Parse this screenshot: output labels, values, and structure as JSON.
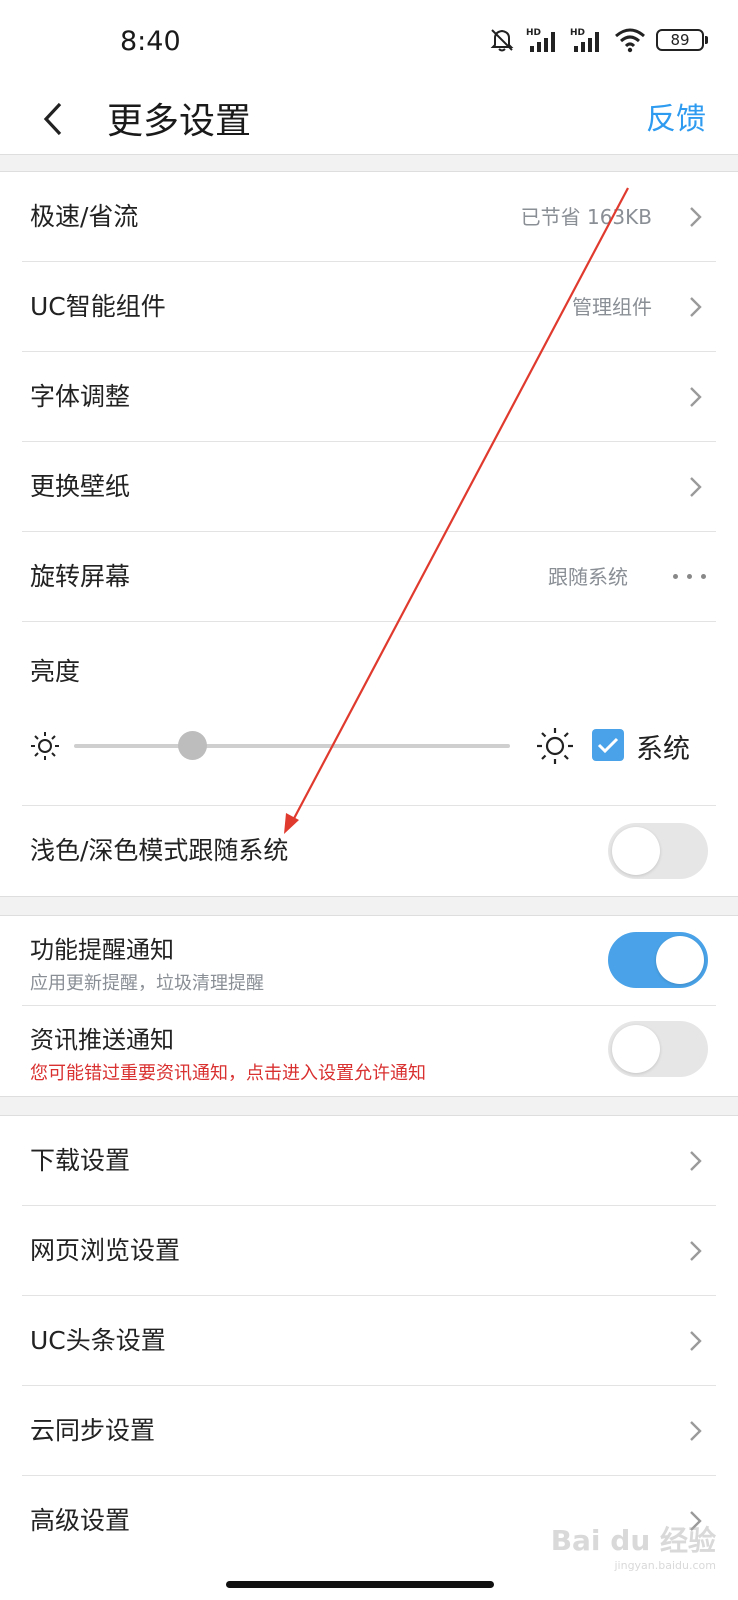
{
  "status_bar": {
    "time": "8:40",
    "battery": "89",
    "network_labels": [
      "HD",
      "HD"
    ]
  },
  "header": {
    "title": "更多设置",
    "feedback": "反馈"
  },
  "section1": {
    "speed": {
      "label": "极速/省流",
      "value": "已节省 163KB"
    },
    "widget": {
      "label": "UC智能组件",
      "value": "管理组件"
    },
    "font": {
      "label": "字体调整"
    },
    "wallpaper": {
      "label": "更换壁纸"
    },
    "rotate": {
      "label": "旋转屏幕",
      "value": "跟随系统"
    },
    "brightness": {
      "label": "亮度",
      "system_label": "系统",
      "system_checked": true,
      "level": 0.27
    },
    "dark_mode": {
      "label": "浅色/深色模式跟随系统",
      "enabled": false
    }
  },
  "section2": {
    "feature_notice": {
      "label": "功能提醒通知",
      "sub": "应用更新提醒，垃圾清理提醒",
      "enabled": true
    },
    "news_notice": {
      "label": "资讯推送通知",
      "sub": "您可能错过重要资讯通知，点击进入设置允许通知",
      "enabled": false
    }
  },
  "section3": {
    "items": [
      {
        "label": "下载设置"
      },
      {
        "label": "网页浏览设置"
      },
      {
        "label": "UC头条设置"
      },
      {
        "label": "云同步设置"
      },
      {
        "label": "高级设置"
      }
    ]
  },
  "watermark": {
    "main": "Bai du 经验",
    "sub": "jingyan.baidu.com"
  },
  "colors": {
    "accent": "#2e9bf0",
    "toggle_on": "#4aa3e8",
    "warning_text": "#d93030",
    "annotation_arrow": "#e03a2e"
  }
}
